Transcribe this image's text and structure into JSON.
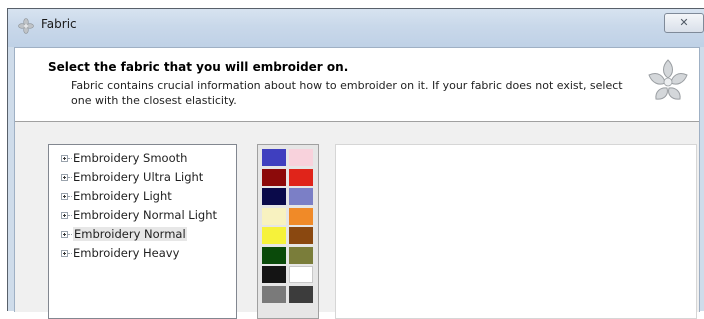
{
  "window": {
    "title": "Fabric",
    "close_label": "✕"
  },
  "header": {
    "title": "Select the fabric that you will embroider on.",
    "description": "Fabric contains crucial information about how to embroider on it. If your fabric does not exist, select one with the closest elasticity."
  },
  "fabrics": [
    {
      "label": "Embroidery Smooth"
    },
    {
      "label": "Embroidery Ultra Light"
    },
    {
      "label": "Embroidery Light"
    },
    {
      "label": "Embroidery Normal Light"
    },
    {
      "label": "Embroidery Normal"
    },
    {
      "label": "Embroidery Heavy"
    }
  ],
  "selected_fabric": "Embroidery Normal",
  "swatches": [
    "#3f3fbf",
    "#f8d2dc",
    "#8c0a0a",
    "#e0241a",
    "#0a0a4a",
    "#7b7fc6",
    "#f8f2c0",
    "#f08a28",
    "#f6f23a",
    "#8a4810",
    "#0a4a0a",
    "#7a7d3a",
    "#141414",
    "#ffffff",
    "#7a7a7a",
    "#3c3c3c"
  ]
}
